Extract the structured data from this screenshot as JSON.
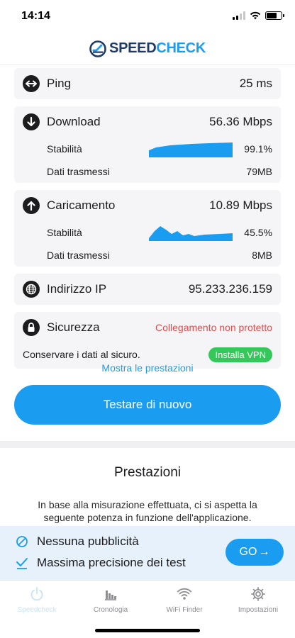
{
  "status": {
    "time": "14:14"
  },
  "header": {
    "logo_speed": "SPEED",
    "logo_check": "CHECK"
  },
  "results": {
    "ping": {
      "label": "Ping",
      "value": "25 ms",
      "icon": "arrows-horizontal-icon"
    },
    "download": {
      "label": "Download",
      "value": "56.36 Mbps",
      "icon": "arrow-down-icon",
      "stability_label": "Stabilità",
      "stability_value": "99.1%",
      "data_label": "Dati trasmessi",
      "data_value": "79MB"
    },
    "upload": {
      "label": "Caricamento",
      "value": "10.89 Mbps",
      "icon": "arrow-up-icon",
      "stability_label": "Stabilità",
      "stability_value": "45.5%",
      "data_label": "Dati trasmessi",
      "data_value": "8MB"
    },
    "ip": {
      "label": "Indirizzo IP",
      "value": "95.233.236.159",
      "icon": "globe-icon"
    },
    "security": {
      "label": "Sicurezza",
      "status": "Collegamento non protetto",
      "icon": "lock-icon",
      "hint": "Conservare i dati al sicuro.",
      "vpn_button": "Installa VPN"
    }
  },
  "show_performance": "Mostra le prestazioni",
  "retest_button": "Testare di nuovo",
  "performance": {
    "title": "Prestazioni",
    "description": "In base alla misurazione effettuata, ci si aspetta la seguente potenza in funzione dell'applicazione."
  },
  "promo": {
    "item1": "Nessuna pubblicità",
    "item2": "Massima precisione dei test",
    "go_label": "GO",
    "go_arrow": "→"
  },
  "tabs": [
    {
      "label": "Speedcheck",
      "icon": "power-icon",
      "active": true
    },
    {
      "label": "Cronologia",
      "icon": "history-chart-icon",
      "active": false
    },
    {
      "label": "WiFi Finder",
      "icon": "wifi-icon",
      "active": false
    },
    {
      "label": "Impostazioni",
      "icon": "gear-icon",
      "active": false
    }
  ],
  "colors": {
    "accent": "#1a9df0",
    "brand_dark": "#1f3a66",
    "warning": "#e24c4c",
    "success": "#34c759",
    "promo_bg": "#e6f1fc"
  }
}
